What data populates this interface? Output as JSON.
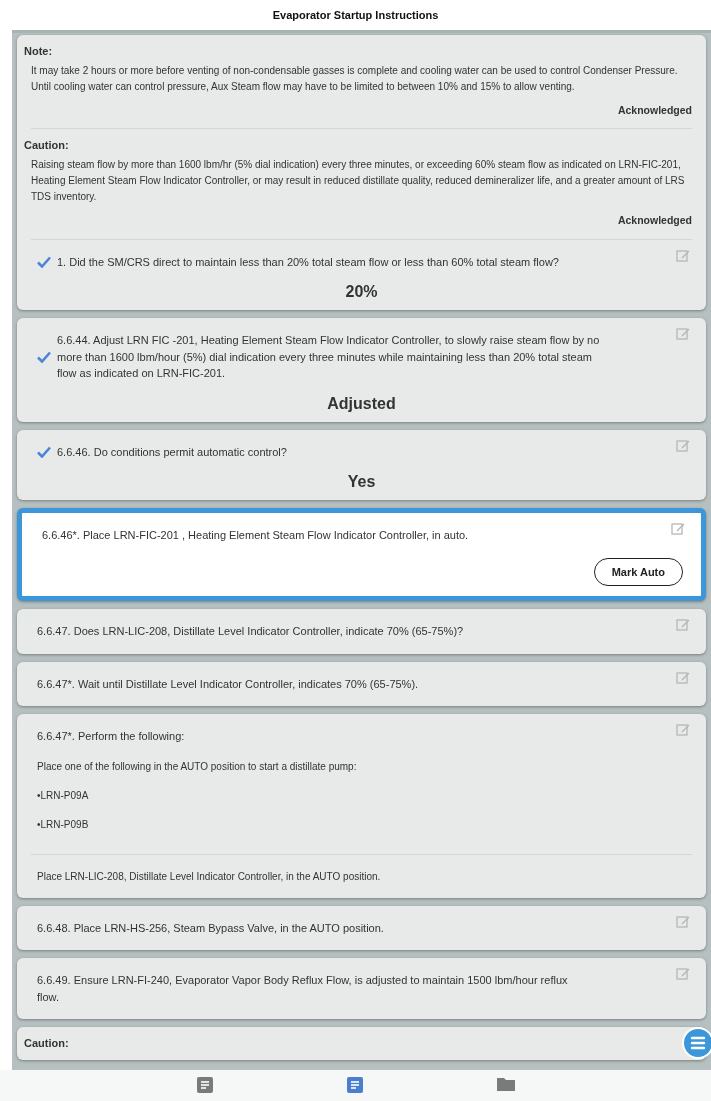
{
  "title": "Evaporator Startup Instructions",
  "cards": [
    {
      "active": false,
      "items": [
        {
          "kind": "note",
          "heading": "Note:",
          "text": "It may take 2 hours or more before venting of non-condensable gasses is complete and cooling water can be used to control Condenser Pressure. Until cooling water can control pressure, Aux Steam flow may have to be limited to between 10% and 15% to allow venting.",
          "status": "Acknowledged"
        },
        {
          "kind": "note",
          "heading": "Caution:",
          "text": "Raising steam flow by more than 1600 lbm/hr (5% dial indication) every three minutes, or exceeding 60% steam flow as indicated on LRN-FIC-201, Heating Element Steam Flow Indicator Controller, or may result in reduced distillate quality, reduced demineralizer life, and a greater amount of LRS TDS inventory.",
          "status": "Acknowledged"
        },
        {
          "kind": "step",
          "checked": true,
          "text": "1.  Did the SM/CRS direct to maintain less than 20% total steam flow or less than 60% total steam flow?",
          "answer": "20%"
        }
      ]
    },
    {
      "active": false,
      "items": [
        {
          "kind": "step",
          "checked": true,
          "text": "6.6.44.  Adjust LRN FIC -201, Heating Element Steam Flow Indicator Controller, to slowly raise steam flow by no more than 1600 lbm/hour (5%) dial indication every three minutes while maintaining less than 20% total steam flow as indicated on LRN-FIC-201.",
          "answer": "Adjusted"
        }
      ]
    },
    {
      "active": false,
      "items": [
        {
          "kind": "step",
          "checked": true,
          "text": "6.6.46.  Do conditions permit automatic control?",
          "answer": "Yes"
        }
      ]
    },
    {
      "active": true,
      "items": [
        {
          "kind": "step",
          "checked": false,
          "text": "6.6.46*.  Place LRN-FIC-201 , Heating Element Steam Flow Indicator Controller, in auto.",
          "button": "Mark Auto"
        }
      ]
    },
    {
      "active": false,
      "items": [
        {
          "kind": "step",
          "checked": false,
          "text": "6.6.47.  Does LRN-LIC-208, Distillate Level Indicator Controller, indicate 70% (65-75%)?"
        }
      ]
    },
    {
      "active": false,
      "items": [
        {
          "kind": "step",
          "checked": false,
          "text": "6.6.47*.  Wait until Distillate Level Indicator Controller, indicates 70% (65-75%)."
        }
      ]
    },
    {
      "active": false,
      "items": [
        {
          "kind": "step",
          "checked": false,
          "text": "6.6.47*.  Perform the following:",
          "details": [
            "Place one of the following in the AUTO position to start a distillate pump:",
            "•LRN-P09A",
            "•LRN-P09B"
          ],
          "footer": "Place LRN-LIC-208, Distillate Level Indicator Controller, in the AUTO position."
        }
      ]
    },
    {
      "active": false,
      "items": [
        {
          "kind": "step",
          "checked": false,
          "text": "6.6.48.  Place LRN-HS-256, Steam Bypass Valve, in the AUTO position."
        }
      ]
    },
    {
      "active": false,
      "items": [
        {
          "kind": "step",
          "checked": false,
          "text": "6.6.49.  Ensure LRN-FI-240, Evaporator Vapor Body Reflux Flow, is adjusted to maintain 1500 lbm/hour reflux flow."
        }
      ]
    },
    {
      "active": false,
      "items": [
        {
          "kind": "heading",
          "heading": "Caution:"
        }
      ]
    }
  ],
  "tabs": [
    {
      "kind": "summary",
      "selected": false
    },
    {
      "kind": "instructions",
      "selected": true
    },
    {
      "kind": "references",
      "selected": false
    }
  ]
}
